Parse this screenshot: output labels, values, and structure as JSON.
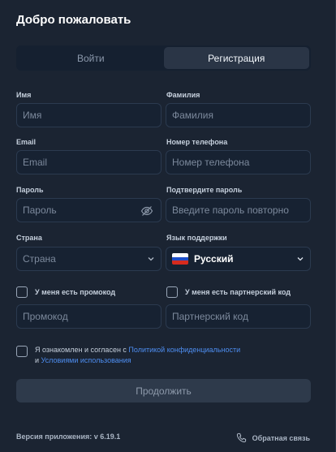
{
  "title": "Добро пожаловать",
  "tabs": {
    "login": "Войти",
    "register": "Регистрация"
  },
  "form": {
    "first_name": {
      "label": "Имя",
      "placeholder": "Имя"
    },
    "last_name": {
      "label": "Фамилия",
      "placeholder": "Фамилия"
    },
    "email": {
      "label": "Email",
      "placeholder": "Email"
    },
    "phone": {
      "label": "Номер телефона",
      "placeholder": "Номер телефона"
    },
    "password": {
      "label": "Пароль",
      "placeholder": "Пароль"
    },
    "password_confirm": {
      "label": "Подтвердите пароль",
      "placeholder": "Введите пароль повторно"
    },
    "country": {
      "label": "Страна",
      "value": "Страна"
    },
    "support_language": {
      "label": "Язык поддержки",
      "value": "Русский"
    },
    "promo_checkbox": {
      "label": "У меня есть промокод",
      "checked": false
    },
    "partner_checkbox": {
      "label": "У меня есть партнерский код",
      "checked": false
    },
    "promo_code": {
      "placeholder": "Промокод"
    },
    "partner_code": {
      "placeholder": "Партнерский код"
    },
    "agreement": {
      "prefix": "Я ознакомлен и согласен с ",
      "privacy_link": "Политикой конфиденциальности",
      "middle": "и ",
      "terms_link": "Условиями использования",
      "checked": false
    }
  },
  "continue_label": "Продолжить",
  "footer": {
    "version": "Версия приложения: v 6.19.1",
    "feedback": "Обратная связь"
  },
  "icons": {
    "eye": "eye-slash-icon",
    "chevron": "chevron-down-icon",
    "flag": "russia-flag-icon",
    "phone": "phone-icon"
  },
  "colors": {
    "background": "#1b2432",
    "field_bg": "#172232",
    "field_border": "#2b3a4f",
    "tab_active": "#2a3546",
    "link": "#4d8df0",
    "button_disabled": "#2e3a4b"
  }
}
